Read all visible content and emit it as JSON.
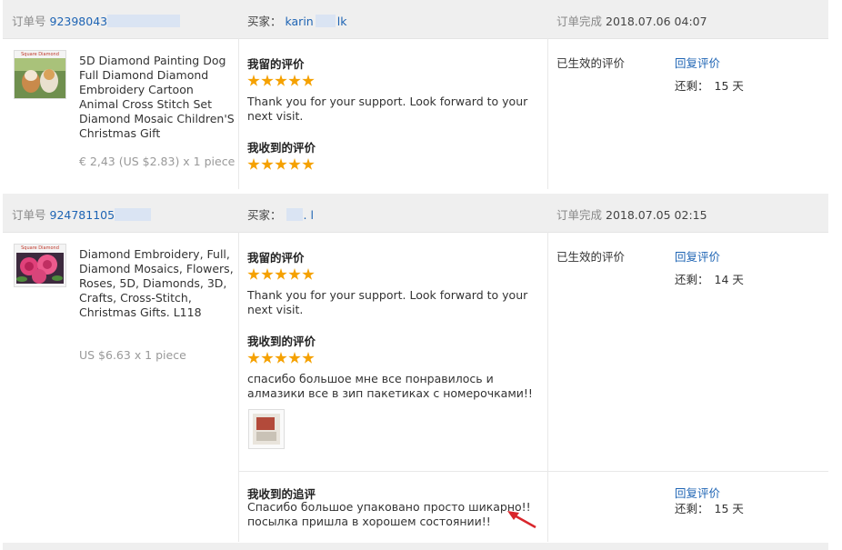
{
  "orders": [
    {
      "order_label": "订单号",
      "order_number": "92398043",
      "buyer_label": "买家：",
      "buyer_name": "karin",
      "buyer_suffix": "lk",
      "completed_label": "订单完成",
      "completed_time": "2018.07.06 04:07",
      "product_title": "5D Diamond Painting Dog Full Diamond Diamond Embroidery Cartoon Animal Cross Stitch Set Diamond Mosaic Children'S Christmas Gift",
      "product_price": "€ 2,43 (US $2.83) x 1 piece",
      "thumb_brand": "Square Diamond",
      "my_review_title": "我留的评价",
      "my_review_stars": 5,
      "my_review_text": "Thank you for your support. Look forward to your next visit.",
      "received_review_title": "我收到的评价",
      "received_review_stars": 5,
      "status": "已生效的评价",
      "reply_label": "回复评价",
      "remaining_label": "还剩：",
      "remaining_days": "15 天"
    },
    {
      "order_label": "订单号",
      "order_number": "924781105",
      "buyer_label": "买家：",
      "buyer_name": "",
      "buyer_suffix": ". l",
      "completed_label": "订单完成",
      "completed_time": "2018.07.05 02:15",
      "product_title": "Diamond Embroidery, Full, Diamond Mosaics, Flowers, Roses, 5D, Diamonds, 3D, Crafts, Cross-Stitch, Christmas Gifts. L118",
      "product_price": "US $6.63 x 1 piece",
      "thumb_brand": "Square Diamond",
      "my_review_title": "我留的评价",
      "my_review_stars": 5,
      "my_review_text": "Thank you for your support. Look forward to your next visit.",
      "received_review_title": "我收到的评价",
      "received_review_stars": 5,
      "received_review_text": "спасибо большое мне все понравилось и алмазики все в зип пакетиках с номерочками!!",
      "status": "已生效的评价",
      "reply_label": "回复评价",
      "remaining_label": "还剩：",
      "remaining_days": "14 天",
      "followup_title": "我收到的追评",
      "followup_text": "Спасибо большое упаковано просто шикарно!! посылка пришла в хорошем состоянии!!",
      "followup_reply_label": "回复评价",
      "followup_remaining_label": "还剩：",
      "followup_remaining_days": "15 天"
    }
  ],
  "colors": {
    "link": "#1e64b4",
    "star": "#f5a100",
    "header_bg": "#efefef",
    "arrow": "#d9262c"
  }
}
